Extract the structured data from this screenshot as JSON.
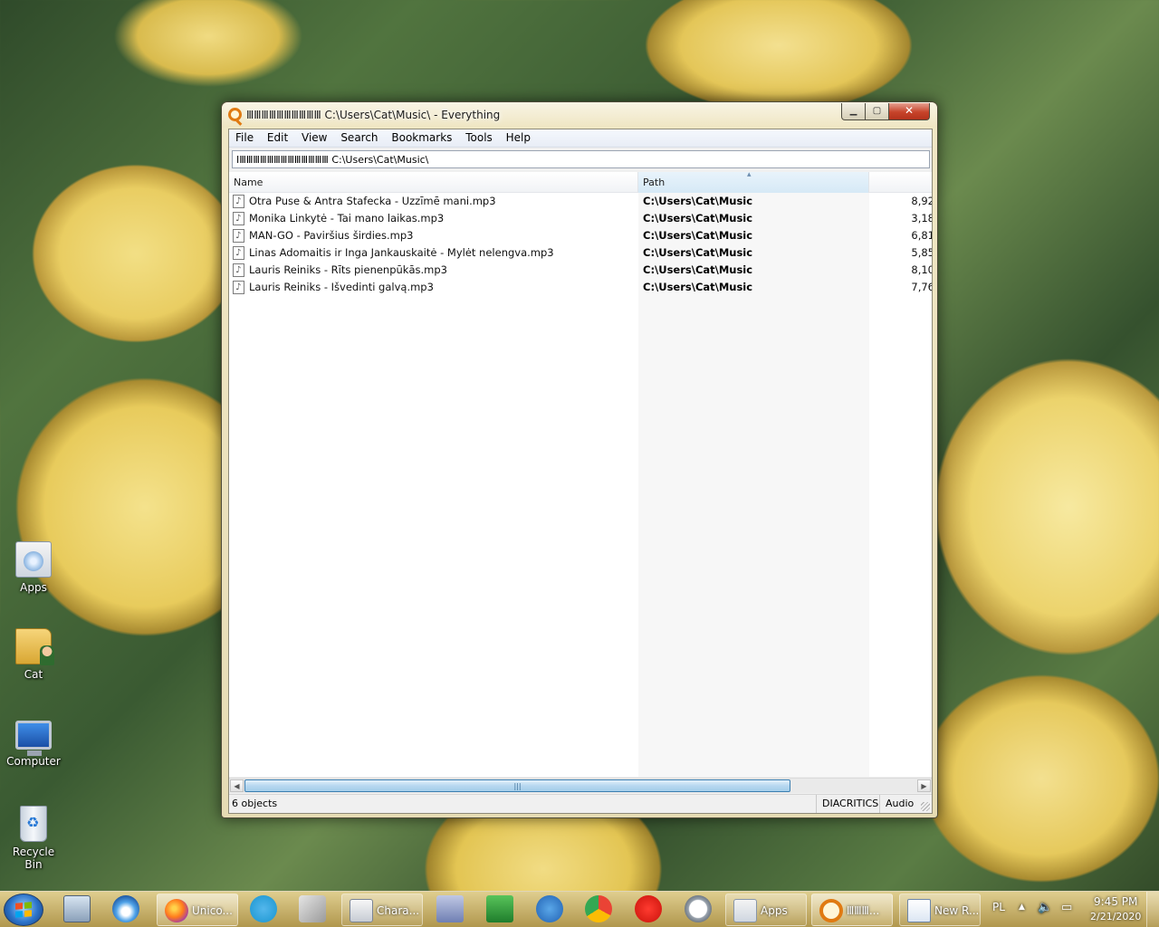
{
  "desktop": {
    "icons": [
      {
        "label": "Apps",
        "icon": "apps-folder-icon"
      },
      {
        "label": "Cat",
        "icon": "user-folder-icon"
      },
      {
        "label": "Computer",
        "icon": "computer-icon"
      },
      {
        "label": "Recycle Bin",
        "icon": "recycle-bin-icon"
      }
    ]
  },
  "window": {
    "title": "ⅢⅢⅢⅢⅢⅢⅢⅢⅢⅢ C:\\Users\\Cat\\Music\\  - Everything",
    "menu": [
      "File",
      "Edit",
      "View",
      "Search",
      "Bookmarks",
      "Tools",
      "Help"
    ],
    "search_value": "ⅠⅢⅢⅢⅢⅢⅢⅢⅢⅢⅢⅢⅢⅢ C:\\Users\\Cat\\Music\\",
    "columns": {
      "name": "Name",
      "path": "Path",
      "size": ""
    },
    "rows": [
      {
        "name": "Otra Puse & Antra Stafecka - Uzzīmē mani.mp3",
        "path": "C:\\Users\\Cat\\Music",
        "size": "8,92"
      },
      {
        "name": "Monika Linkytė - Tai mano laikas.mp3",
        "path": "C:\\Users\\Cat\\Music",
        "size": "3,18"
      },
      {
        "name": "MAN-GO - Paviršius širdies.mp3",
        "path": "C:\\Users\\Cat\\Music",
        "size": "6,81"
      },
      {
        "name": "Linas Adomaitis ir Inga Jankauskaitė - Mylėt nelengva.mp3",
        "path": "C:\\Users\\Cat\\Music",
        "size": "5,85"
      },
      {
        "name": "Lauris Reiniks - Rīts pienenpūkās.mp3",
        "path": "C:\\Users\\Cat\\Music",
        "size": "8,10"
      },
      {
        "name": "Lauris Reiniks - Išvedinti galvą.mp3",
        "path": "C:\\Users\\Cat\\Music",
        "size": "7,76"
      }
    ],
    "status": {
      "count": "6 objects",
      "diacritics": "DIACRITICS",
      "filter": "Audio"
    }
  },
  "taskbar": {
    "buttons": [
      {
        "label": "Unico...",
        "icon": "firefox-icon"
      },
      {
        "label": "Chara...",
        "icon": "character-map-icon"
      },
      {
        "label": "Apps",
        "icon": "apps-folder-icon"
      },
      {
        "label": "ⅢⅢⅢ...",
        "icon": "everything-search-icon"
      },
      {
        "label": "New R...",
        "icon": "wordpad-icon"
      }
    ],
    "language": "PL",
    "time": "9:45 PM",
    "date": "2/21/2020"
  }
}
